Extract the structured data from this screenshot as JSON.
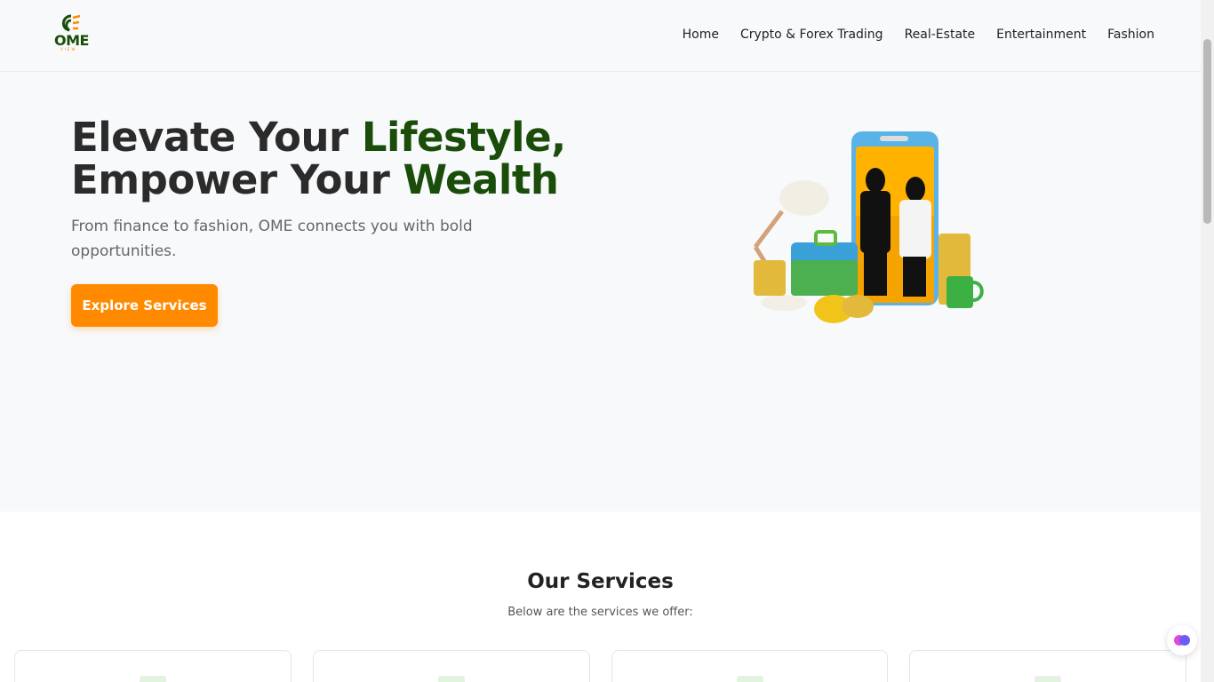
{
  "brand": {
    "logo_text": "OME",
    "logo_sub": "VIEW"
  },
  "nav": {
    "items": [
      "Home",
      "Crypto & Forex Trading",
      "Real-Estate",
      "Entertainment",
      "Fashion"
    ]
  },
  "hero": {
    "title_line1_a": "Elevate Your ",
    "title_line1_b": "Lifestyle,",
    "title_line2_a": "Empower Your ",
    "title_line2_b": "Wealth",
    "subtitle": "From finance to fashion, OME connects you with bold opportunities.",
    "cta_label": "Explore Services"
  },
  "services": {
    "title": "Our Services",
    "subtitle": "Below are the services we offer:"
  },
  "colors": {
    "accent": "#ff8a00",
    "brand_green": "#1a4d0a"
  }
}
